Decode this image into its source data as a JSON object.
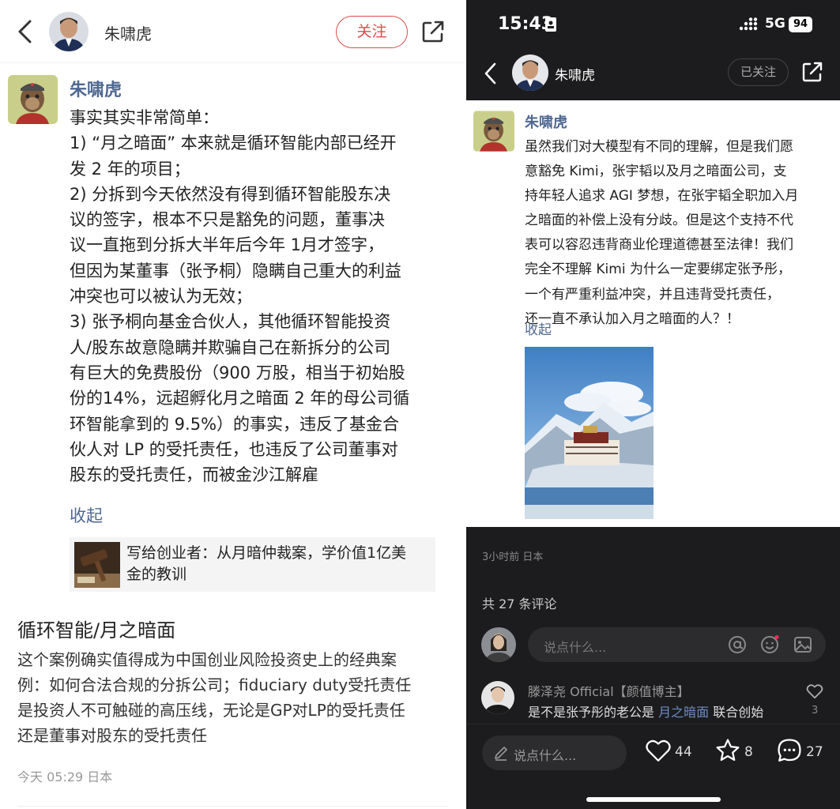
{
  "left": {
    "header": {
      "name": "朱啸虎",
      "follow_label": "关注"
    },
    "post": {
      "author": "朱啸虎",
      "body_lines": [
        "事实其实非常简单：",
        "1) “月之暗面” 本来就是循环智能内部已经开",
        "发 2 年的项目；",
        "2) 分拆到今天依然没有得到循环智能股东决",
        "议的签字，根本不只是豁免的问题，董事决",
        "议一直拖到分拆大半年后今年 1月才签字，",
        "但因为某董事（张予桐）隐瞒自己重大的利益",
        "冲突也可以被认为无效；",
        "3) 张予桐向基金合伙人，其他循环智能投资",
        "人/股东故意隐瞒并欺骗自己在新拆分的公司",
        "有巨大的免费股份（900 万股，相当于初始股",
        "份的14%，远超孵化月之暗面 2 年的母公司循",
        "环智能拿到的 9.5%）的事实，违反了基金合",
        "伙人对 LP 的受托责任，也违反了公司董事对",
        "股东的受托责任，而被金沙江解雇"
      ],
      "collapse_label": "收起",
      "link_card_lines": [
        "写给创业者：从月暗仲裁案，学价值1亿美",
        "金的教训"
      ]
    },
    "topic": {
      "title": "循环智能/月之暗面",
      "desc_lines": [
        "这个案例确实值得成为中国创业风险投资史上的经典案",
        "例：如何合法合规的分拆公司；fiduciary duty受托责任",
        "是投资人不可触碰的高压线，无论是GP对LP的受托责任",
        "还是董事对股东的受托责任"
      ],
      "time": "今天 05:29 日本"
    }
  },
  "right": {
    "status_bar": {
      "time": "15:43",
      "network": "5G",
      "battery": "94"
    },
    "header": {
      "name": "朱啸虎",
      "follow_label": "已关注"
    },
    "post": {
      "author": "朱啸虎",
      "body_lines": [
        "虽然我们对大模型有不同的理解，但是我们愿",
        "意豁免 Kimi，张宇韬以及月之暗面公司，支",
        "持年轻人追求 AGI 梦想，在张宇韬全职加入月",
        "之暗面的补偿上没有分歧。但是这个支持不代",
        "表可以容忍违背商业伦理道德甚至法律！我们",
        "完全不理解 Kimi 为什么一定要绑定张予彤，",
        "一个有严重利益冲突，并且违背受托责任，",
        "还一直不承认加入月之暗面的人？！"
      ],
      "collapse_label": "收起",
      "meta": "3小时前 日本"
    },
    "comments": {
      "count_label": "共 27 条评论",
      "input_placeholder": "说点什么...",
      "first": {
        "author": "滕泽尧 Official【颜值博主】",
        "text_before": "是不是张予彤的老公是 ",
        "tag": "月之暗面",
        "text_after": " 联合创始",
        "likes": "3"
      }
    },
    "bottom_bar": {
      "input_placeholder": "说点什么...",
      "likes": "44",
      "stars": "8",
      "comments": "27"
    }
  }
}
